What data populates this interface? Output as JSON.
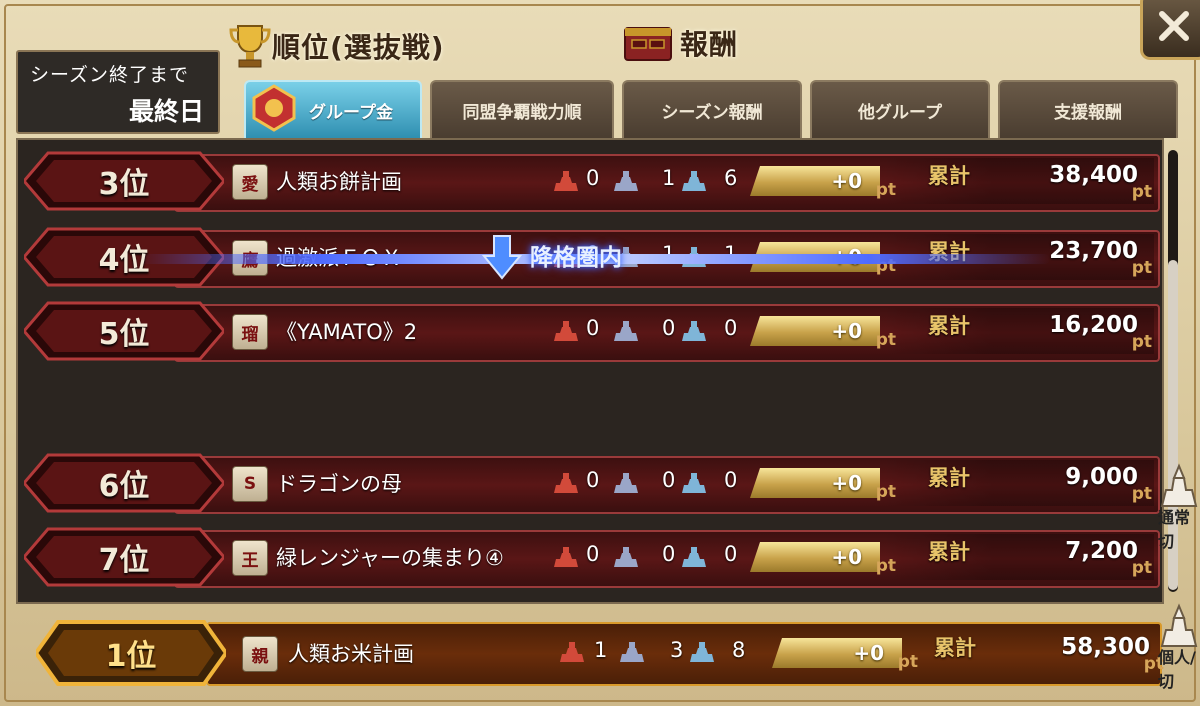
{
  "header": {
    "season_line1": "シーズン終了まで",
    "season_line2": "最終日",
    "ranking_title": "順位(選抜戦)",
    "reward_title": "報酬"
  },
  "tabs": [
    {
      "label": "グループ金",
      "active": true
    },
    {
      "label": "同盟争覇戦力順",
      "active": false
    },
    {
      "label": "シーズン報酬",
      "active": false
    },
    {
      "label": "他グループ",
      "active": false
    },
    {
      "label": "支援報酬",
      "active": false
    }
  ],
  "rows": [
    {
      "rank": "3位",
      "emblem": "愛",
      "name": "人類お餅計画",
      "c1": "0",
      "c2": "1",
      "c3": "6",
      "pt": "+0",
      "pt_unit": "pt",
      "total_label": "累計",
      "total": "38,400",
      "total_unit": "pt"
    },
    {
      "rank": "4位",
      "emblem": "鷹",
      "name": "過激派ＦＯＸ",
      "c1": "0",
      "c2": "1",
      "c3": "1",
      "pt": "+0",
      "pt_unit": "pt",
      "total_label": "累計",
      "total": "23,700",
      "total_unit": "pt"
    },
    {
      "rank": "5位",
      "emblem": "瑠",
      "name": "《YAMATO》2",
      "c1": "0",
      "c2": "0",
      "c3": "0",
      "pt": "+0",
      "pt_unit": "pt",
      "total_label": "累計",
      "total": "16,200",
      "total_unit": "pt"
    },
    {
      "rank": "6位",
      "emblem": "S",
      "name": "ドラゴンの母",
      "c1": "0",
      "c2": "0",
      "c3": "0",
      "pt": "+0",
      "pt_unit": "pt",
      "total_label": "累計",
      "total": "9,000",
      "total_unit": "pt"
    },
    {
      "rank": "7位",
      "emblem": "王",
      "name": "緑レンジャーの集まり④",
      "c1": "0",
      "c2": "0",
      "c3": "0",
      "pt": "+0",
      "pt_unit": "pt",
      "total_label": "累計",
      "total": "7,200",
      "total_unit": "pt"
    }
  ],
  "relegation_label": "降格圏内",
  "my_row": {
    "rank": "1位",
    "emblem": "親",
    "name": "人類お米計画",
    "c1": "1",
    "c2": "3",
    "c3": "8",
    "pt": "+0",
    "pt_unit": "pt",
    "total_label": "累計",
    "total": "58,300",
    "total_unit": "pt"
  },
  "side_buttons": {
    "top_label_1": "通常",
    "top_label_2": "切",
    "bottom_label_1": "個人/",
    "bottom_label_2": "切"
  },
  "colors": {
    "rank_red": "#6a1414",
    "gold_accent": "#e9c46a",
    "active_tab": "#4fb2d3",
    "relegation_blue": "#4f6bff"
  }
}
